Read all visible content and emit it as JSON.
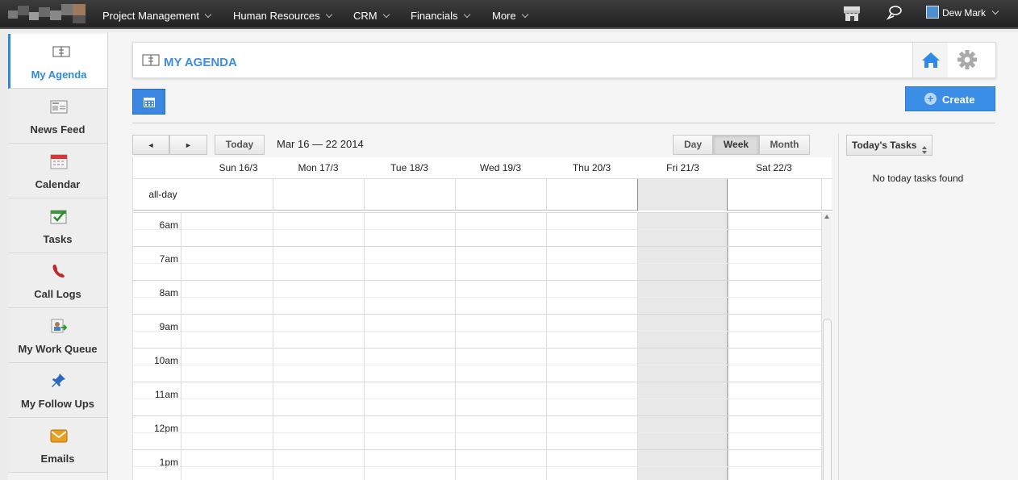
{
  "nav": {
    "menus": [
      {
        "label": "Project Management"
      },
      {
        "label": "Human Resources"
      },
      {
        "label": "CRM"
      },
      {
        "label": "Financials"
      },
      {
        "label": "More"
      }
    ],
    "user_name": "Dew Mark"
  },
  "sidebar": {
    "items": [
      {
        "label": "My Agenda",
        "icon": "agenda-icon"
      },
      {
        "label": "News Feed",
        "icon": "newspaper-icon"
      },
      {
        "label": "Calendar",
        "icon": "calendar-icon"
      },
      {
        "label": "Tasks",
        "icon": "tasks-check-icon"
      },
      {
        "label": "Call Logs",
        "icon": "phone-icon"
      },
      {
        "label": "My Work Queue",
        "icon": "work-queue-icon"
      },
      {
        "label": "My Follow Ups",
        "icon": "pin-icon"
      },
      {
        "label": "Emails",
        "icon": "envelope-icon"
      }
    ]
  },
  "header": {
    "title": "MY AGENDA"
  },
  "toolbar": {
    "create_label": "Create"
  },
  "calendar": {
    "prev_label": "◄",
    "next_label": "►",
    "today_label": "Today",
    "date_range": "Mar 16 — 22 2014",
    "views": {
      "day": "Day",
      "week": "Week",
      "month": "Month"
    },
    "active_view": "Week",
    "days": [
      "Sun 16/3",
      "Mon 17/3",
      "Tue 18/3",
      "Wed 19/3",
      "Thu 20/3",
      "Fri 21/3",
      "Sat 22/3"
    ],
    "highlighted_day": "Fri 21/3",
    "allday_label": "all-day",
    "times": [
      "6am",
      "7am",
      "8am",
      "9am",
      "10am",
      "11am",
      "12pm",
      "1pm"
    ]
  },
  "tasks_panel": {
    "button_label": "Today's Tasks",
    "empty_text": "No today tasks found"
  },
  "colors": {
    "accent": "#3a8ee6",
    "topbar": "#2c2c2c",
    "highlight_column": "#e8e8e8"
  }
}
